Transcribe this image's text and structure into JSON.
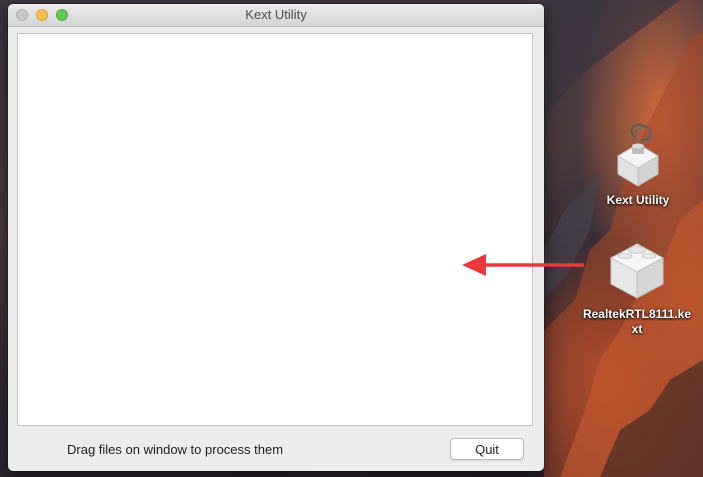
{
  "window": {
    "title": "Kext Utility",
    "instructions": "Drag files on window to process them",
    "quit_label": "Quit"
  },
  "desktop": {
    "icons": [
      {
        "label": "Kext Utility",
        "icon": "kext-utility-app-icon"
      },
      {
        "label_line1": "RealtekRTL8111.ke",
        "label_line2": "xt",
        "icon": "kext-bundle-icon"
      }
    ]
  },
  "colors": {
    "annotation_arrow": "#e8383d",
    "zoom_button": "#62c655",
    "minimize_button": "#f6be4f"
  }
}
